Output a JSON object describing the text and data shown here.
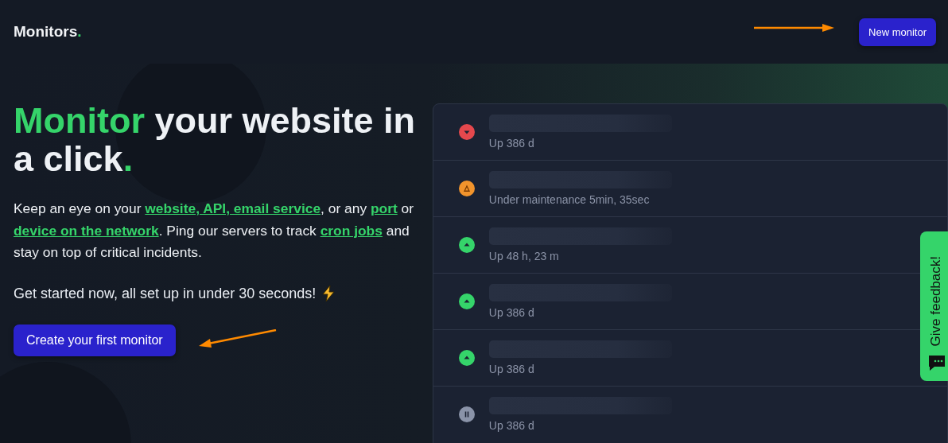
{
  "header": {
    "logo": [
      {
        "text": "Monitors",
        "accent": false
      },
      {
        "text": ".",
        "accent": true
      }
    ],
    "button": "New monitor"
  },
  "hero": {
    "headline": [
      {
        "text": "Monitor",
        "accent": true
      },
      {
        "text": " your website in a click",
        "accent": false
      },
      {
        "text": ".",
        "accent": true
      }
    ],
    "intro": [
      {
        "kind": "plain",
        "text": "Keep an eye on your "
      },
      {
        "kind": "link",
        "text": "website, API, email service"
      },
      {
        "kind": "plain",
        "text": ", or any "
      },
      {
        "kind": "link",
        "text": "port"
      },
      {
        "kind": "plain",
        "text": " or "
      },
      {
        "kind": "link",
        "text": "device on the network"
      },
      {
        "kind": "plain",
        "text": ". Ping our servers to track "
      },
      {
        "kind": "link",
        "text": "cron jobs"
      },
      {
        "kind": "plain",
        "text": " and stay on top of critical incidents."
      }
    ],
    "tagline": "Get started now, all set up in under 30 seconds!",
    "button": "Create your first monitor"
  },
  "monitors": [
    {
      "kind": "down",
      "detail": "Up 386 d"
    },
    {
      "kind": "maintenance",
      "detail": "Under maintenance 5min, 35sec"
    },
    {
      "kind": "up",
      "detail": "Up 48 h, 23 m"
    },
    {
      "kind": "up",
      "detail": "Up 386 d"
    },
    {
      "kind": "up",
      "detail": "Up 386 d"
    },
    {
      "kind": "paused",
      "detail": "Up 386 d"
    }
  ],
  "feedback_tab": "Give feedback!"
}
